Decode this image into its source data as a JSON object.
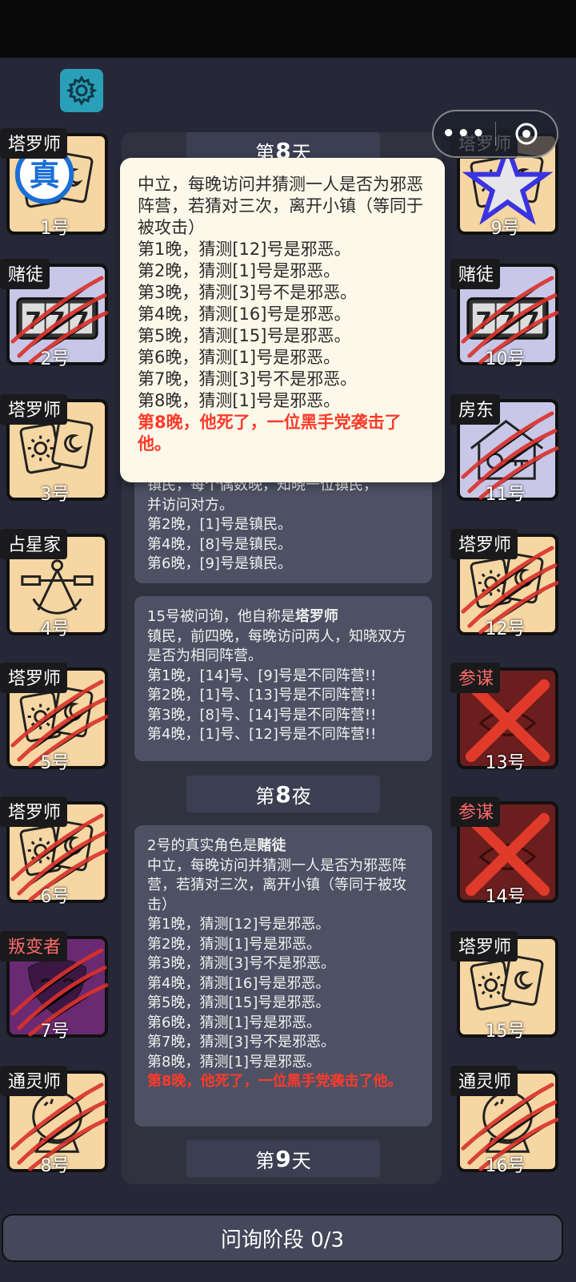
{
  "days": {
    "day8": {
      "prefix": "第",
      "num": "8",
      "suffix": "天"
    },
    "night8": {
      "prefix": "第",
      "num": "8",
      "suffix": "夜"
    },
    "day9": {
      "prefix": "第",
      "num": "9",
      "suffix": "天"
    }
  },
  "popup": {
    "lines": [
      "中立，每晚访问并猜测一人是否为邪恶阵营，若猜对三次，离开小镇（等同于被攻击）",
      "第1晚，猜测[12]号是邪恶。",
      "第2晚，猜测[1]号是邪恶。",
      "第3晚，猜测[3]号不是邪恶。",
      "第4晚，猜测[16]号是邪恶。",
      "第5晚，猜测[15]号是邪恶。",
      "第6晚，猜测[1]号是邪恶。",
      "第7晚，猜测[3]号不是邪恶。",
      "第8晚，猜测[1]号是邪恶。"
    ],
    "death": "第8晚，他死了，一位黑手党袭击了他。"
  },
  "log_card_a": {
    "lines": [
      "镇民，每个偶数晚，知晓一位镇民，",
      "并访问对方。",
      "第2晚，[1]号是镇民。",
      "第4晚，[8]号是镇民。",
      "第6晚，[9]号是镇民。"
    ]
  },
  "log_card_b": {
    "head_pre": "15号被问询，他自称是",
    "head_role": "塔罗师",
    "lines": [
      "镇民，前四晚，每晚访问两人，知晓双方是否为相同阵营。",
      "第1晚，[14]号、[9]号是不同阵营!!",
      "第2晚，[1]号、[13]号是不同阵营!!",
      "第3晚，[8]号、[14]号是不同阵营!!",
      "第4晚，[1]号、[12]号是不同阵营!!"
    ]
  },
  "log_card_c": {
    "head_pre": "2号的真实角色是",
    "head_role": "赌徒",
    "lines": [
      "中立，每晚访问并猜测一人是否为邪恶阵营，若猜对三次，离开小镇（等同于被攻击）",
      "第1晚，猜测[12]号是邪恶。",
      "第2晚，猜测[1]号是邪恶。",
      "第3晚，猜测[3]号不是邪恶。",
      "第4晚，猜测[16]号是邪恶。",
      "第5晚，猜测[15]号是邪恶。",
      "第6晚，猜测[1]号是邪恶。",
      "第7晚，猜测[3]号不是邪恶。",
      "第8晚，猜测[1]号是邪恶。"
    ],
    "death": "第8晚，他死了，一位黑手党袭击了他。"
  },
  "left_players": [
    {
      "role": "塔罗师",
      "num": "1号",
      "badge": "真"
    },
    {
      "role": "赌徒",
      "num": "2号"
    },
    {
      "role": "塔罗师",
      "num": "3号"
    },
    {
      "role": "占星家",
      "num": "4号"
    },
    {
      "role": "塔罗师",
      "num": "5号"
    },
    {
      "role": "塔罗师",
      "num": "6号"
    },
    {
      "role": "叛变者",
      "num": "7号"
    },
    {
      "role": "通灵师",
      "num": "8号"
    }
  ],
  "right_players": [
    {
      "role": "塔罗师",
      "num": "9号"
    },
    {
      "role": "赌徒",
      "num": "10号"
    },
    {
      "role": "房东",
      "num": "11号"
    },
    {
      "role": "塔罗师",
      "num": "12号"
    },
    {
      "role": "参谋",
      "num": "13号"
    },
    {
      "role": "参谋",
      "num": "14号"
    },
    {
      "role": "塔罗师",
      "num": "15号"
    },
    {
      "role": "通灵师",
      "num": "16号"
    }
  ],
  "bottom": {
    "label": "问询阶段 0/3"
  },
  "colors": {
    "tarot_bg": "#f6d6a2",
    "gambler_bg": "#c8c7e8",
    "consigliere_bg": "#6b1e1e",
    "traitor_bg": "#6a2a72",
    "death_text": "#ff3a2a",
    "settings_bg": "#2a9fb8"
  }
}
